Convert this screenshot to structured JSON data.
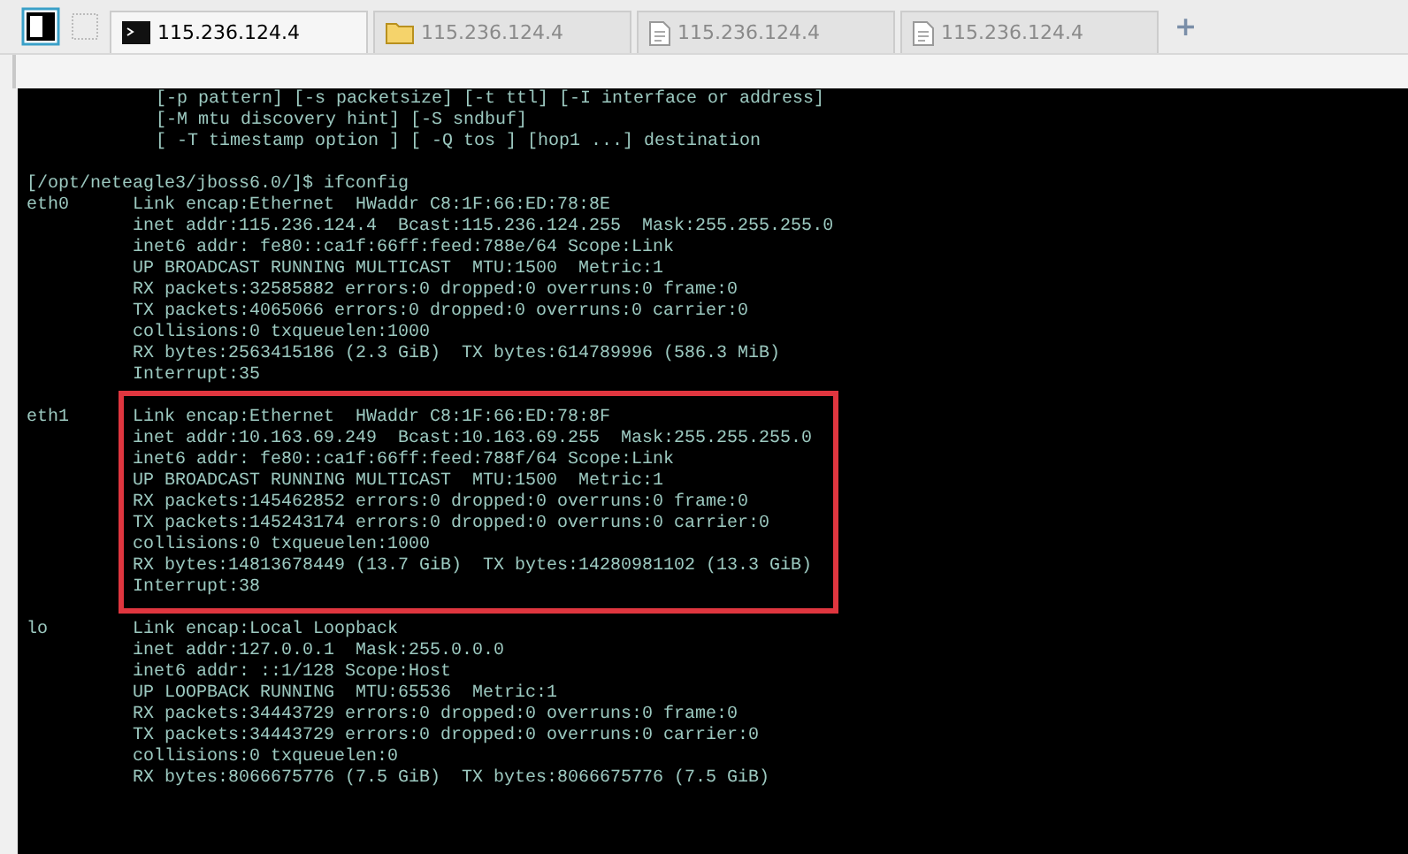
{
  "tabs": [
    {
      "label": "115.236.124.4",
      "kind": "terminal",
      "selected": true
    },
    {
      "label": "115.236.124.4",
      "kind": "folder",
      "selected": false
    },
    {
      "label": "115.236.124.4",
      "kind": "document",
      "selected": false
    },
    {
      "label": "115.236.124.4",
      "kind": "document",
      "selected": false
    }
  ],
  "new_tab": "+",
  "terminal": {
    "usage": [
      "[-p pattern] [-s packetsize] [-t ttl] [-I interface or address]",
      "[-M mtu discovery hint] [-S sndbuf]",
      "[ -T timestamp option ] [ -Q tos ] [hop1 ...] destination"
    ],
    "prompt": "[/opt/neteagle3/jboss6.0/]$ ifconfig",
    "interfaces": [
      {
        "name": "eth0",
        "highlighted": false,
        "lines": [
          "Link encap:Ethernet  HWaddr C8:1F:66:ED:78:8E",
          "inet addr:115.236.124.4  Bcast:115.236.124.255  Mask:255.255.255.0",
          "inet6 addr: fe80::ca1f:66ff:feed:788e/64 Scope:Link",
          "UP BROADCAST RUNNING MULTICAST  MTU:1500  Metric:1",
          "RX packets:32585882 errors:0 dropped:0 overruns:0 frame:0",
          "TX packets:4065066 errors:0 dropped:0 overruns:0 carrier:0",
          "collisions:0 txqueuelen:1000",
          "RX bytes:2563415186 (2.3 GiB)  TX bytes:614789996 (586.3 MiB)",
          "Interrupt:35"
        ]
      },
      {
        "name": "eth1",
        "highlighted": true,
        "lines": [
          "Link encap:Ethernet  HWaddr C8:1F:66:ED:78:8F",
          "inet addr:10.163.69.249  Bcast:10.163.69.255  Mask:255.255.255.0",
          "inet6 addr: fe80::ca1f:66ff:feed:788f/64 Scope:Link",
          "UP BROADCAST RUNNING MULTICAST  MTU:1500  Metric:1",
          "RX packets:145462852 errors:0 dropped:0 overruns:0 frame:0",
          "TX packets:145243174 errors:0 dropped:0 overruns:0 carrier:0",
          "collisions:0 txqueuelen:1000",
          "RX bytes:14813678449 (13.7 GiB)  TX bytes:14280981102 (13.3 GiB)",
          "Interrupt:38"
        ]
      },
      {
        "name": "lo",
        "highlighted": false,
        "lines": [
          "Link encap:Local Loopback",
          "inet addr:127.0.0.1  Mask:255.0.0.0",
          "inet6 addr: ::1/128 Scope:Host",
          "UP LOOPBACK RUNNING  MTU:65536  Metric:1",
          "RX packets:34443729 errors:0 dropped:0 overruns:0 frame:0",
          "TX packets:34443729 errors:0 dropped:0 overruns:0 carrier:0",
          "collisions:0 txqueuelen:0",
          "RX bytes:8066675776 (7.5 GiB)  TX bytes:8066675776 (7.5 GiB)"
        ]
      }
    ]
  }
}
